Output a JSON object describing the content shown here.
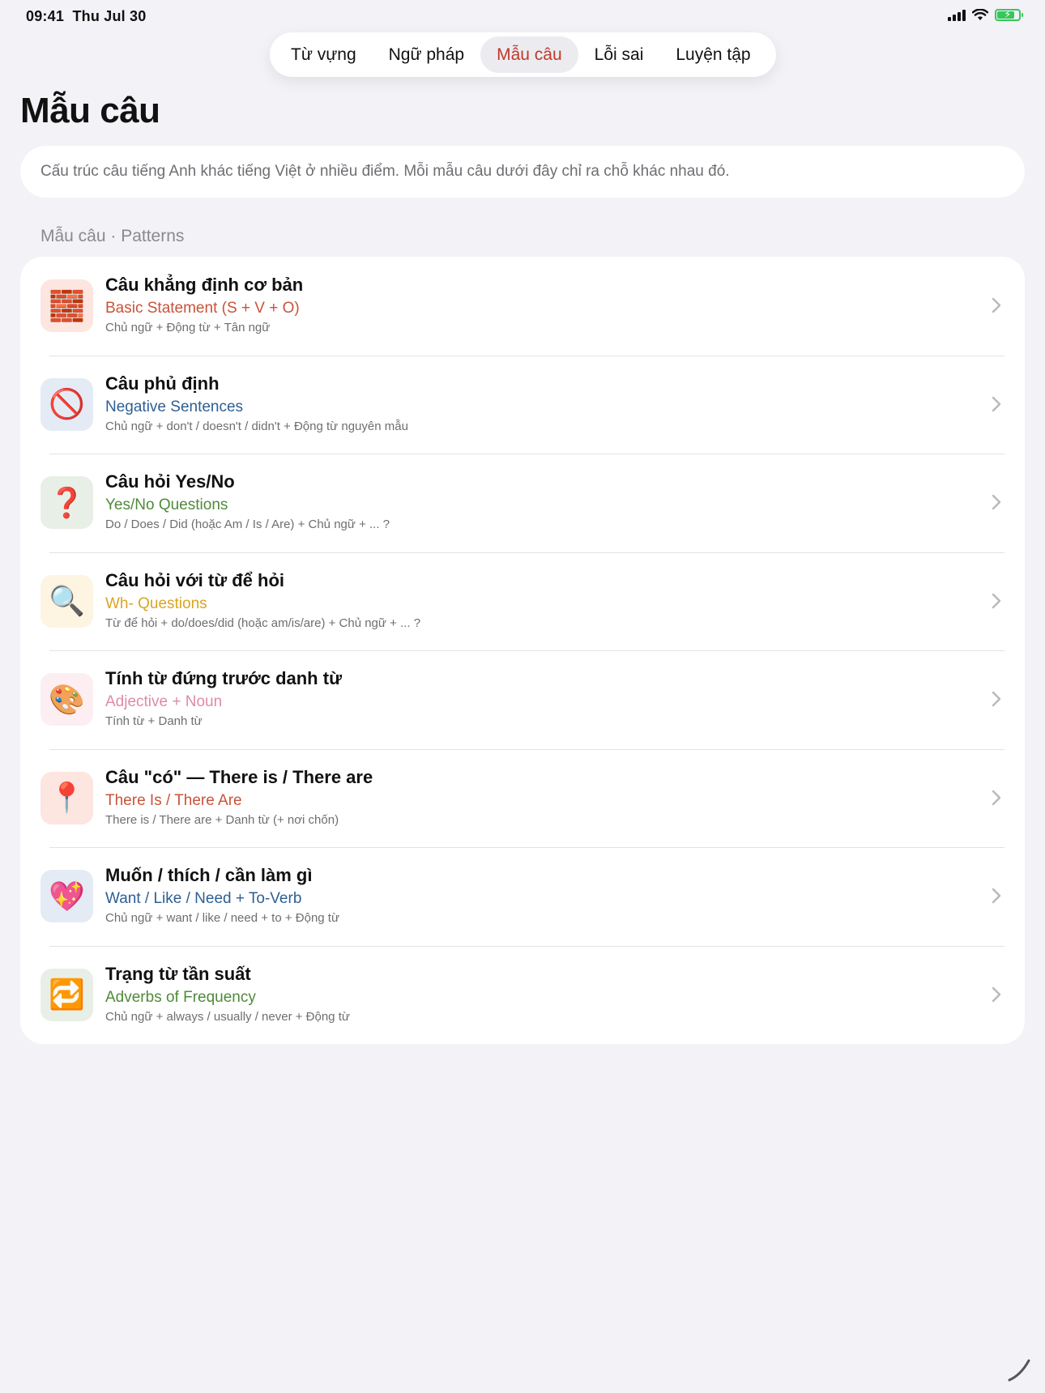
{
  "status": {
    "time": "09:41",
    "date": "Thu Jul 30",
    "battery_level": 0.8,
    "accent_color": "#34c759"
  },
  "nav": {
    "tabs": [
      {
        "label": "Từ vựng",
        "active": false
      },
      {
        "label": "Ngữ pháp",
        "active": false
      },
      {
        "label": "Mẫu câu",
        "active": true
      },
      {
        "label": "Lỗi sai",
        "active": false
      },
      {
        "label": "Luyện tập",
        "active": false
      }
    ],
    "active_color": "#c0392b"
  },
  "page": {
    "title": "Mẫu câu",
    "intro": "Cấu trúc câu tiếng Anh khác tiếng Việt ở nhiều điểm. Mỗi mẫu câu dưới đây chỉ ra chỗ khác nhau đó.",
    "section_label": "Mẫu câu · Patterns"
  },
  "patterns": [
    {
      "icon": "brick-icon",
      "glyph": "🧱",
      "icon_bg": "#fde5e0",
      "title": "Câu khẳng định cơ bản",
      "subtitle": "Basic Statement (S + V + O)",
      "subtitle_color": "#c8533a",
      "formula": "Chủ ngữ + Động từ + Tân ngữ"
    },
    {
      "icon": "prohibited-icon",
      "glyph": "🚫",
      "icon_bg": "#e4ebf4",
      "title": "Câu phủ định",
      "subtitle": "Negative Sentences",
      "subtitle_color": "#2d5f93",
      "formula": "Chủ ngữ + don't / doesn't / didn't + Động từ nguyên mẫu"
    },
    {
      "icon": "question-mark-icon",
      "glyph": "❓",
      "icon_bg": "#e8efe6",
      "title": "Câu hỏi Yes/No",
      "subtitle": "Yes/No Questions",
      "subtitle_color": "#4f8a3a",
      "formula": "Do / Does / Did (hoặc Am / Is / Are) + Chủ ngữ + ... ?"
    },
    {
      "icon": "magnifier-icon",
      "glyph": "🔍",
      "icon_bg": "#fdf4e2",
      "title": "Câu hỏi với từ để hỏi",
      "subtitle": "Wh- Questions",
      "subtitle_color": "#d9a521",
      "formula": "Từ để hỏi + do/does/did (hoặc am/is/are) + Chủ ngữ + ... ?"
    },
    {
      "icon": "palette-icon",
      "glyph": "🎨",
      "icon_bg": "#fdeef2",
      "title": "Tính từ đứng trước danh từ",
      "subtitle": "Adjective + Noun",
      "subtitle_color": "#e08aa6",
      "formula": "Tính từ + Danh từ"
    },
    {
      "icon": "pushpin-icon",
      "glyph": "📍",
      "icon_bg": "#fde5e0",
      "title": "Câu \"có\" — There is / There are",
      "subtitle": "There Is / There Are",
      "subtitle_color": "#c8533a",
      "formula": "There is / There are + Danh từ (+ nơi chốn)"
    },
    {
      "icon": "sparkling-heart-icon",
      "glyph": "💖",
      "icon_bg": "#e4ebf4",
      "title": "Muốn / thích / cần làm gì",
      "subtitle": "Want / Like / Need + To-Verb",
      "subtitle_color": "#2d5f93",
      "formula": "Chủ ngữ + want / like / need + to + Động từ"
    },
    {
      "icon": "repeat-icon",
      "glyph": "🔁",
      "icon_bg": "#e8efe6",
      "title": "Trạng từ tần suất",
      "subtitle": "Adverbs of Frequency",
      "subtitle_color": "#4f8a3a",
      "formula": "Chủ ngữ + always / usually / never + Động từ"
    }
  ]
}
